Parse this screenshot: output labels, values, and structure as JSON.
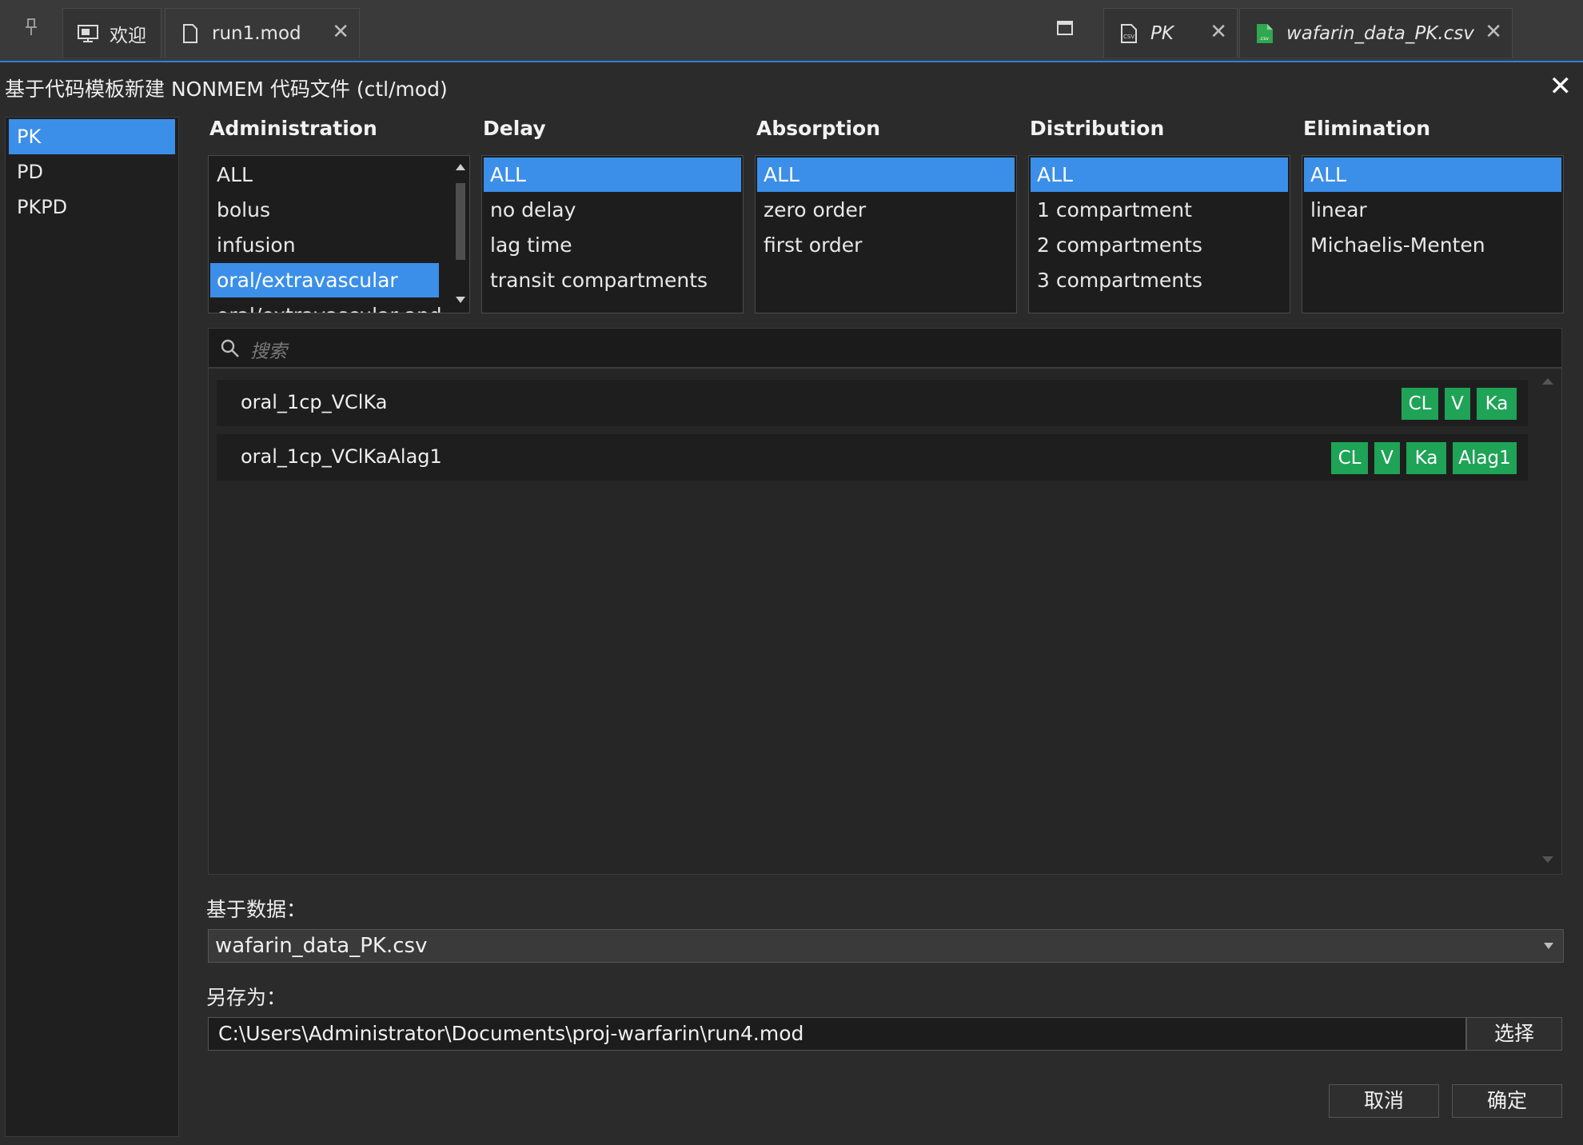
{
  "tabs": [
    {
      "label": "欢迎",
      "icon": "monitor-icon"
    },
    {
      "label": "run1.mod",
      "icon": "file-icon"
    },
    {
      "label": "PK",
      "icon": "csv-file-icon"
    },
    {
      "label": "wafarin_data_PK.csv",
      "icon": "csv-green-icon"
    }
  ],
  "dialog": {
    "title": "基于代码模板新建 NONMEM 代码文件 (ctl/mod)",
    "close_label": "✕"
  },
  "sidebar": {
    "items": [
      {
        "label": "PK",
        "selected": true
      },
      {
        "label": "PD",
        "selected": false
      },
      {
        "label": "PKPD",
        "selected": false
      }
    ]
  },
  "filters": {
    "administration": {
      "title": "Administration",
      "options": [
        "ALL",
        "bolus",
        "infusion",
        "oral/extravascular",
        "oral/extravascular and ..."
      ],
      "selected": "oral/extravascular"
    },
    "delay": {
      "title": "Delay",
      "options": [
        "ALL",
        "no delay",
        "lag time",
        "transit compartments"
      ],
      "selected": "ALL"
    },
    "absorption": {
      "title": "Absorption",
      "options": [
        "ALL",
        "zero order",
        "first order"
      ],
      "selected": "ALL"
    },
    "distribution": {
      "title": "Distribution",
      "options": [
        "ALL",
        "1 compartment",
        "2 compartments",
        "3 compartments"
      ],
      "selected": "ALL"
    },
    "elimination": {
      "title": "Elimination",
      "options": [
        "ALL",
        "linear",
        "Michaelis-Menten"
      ],
      "selected": "ALL"
    }
  },
  "search": {
    "placeholder": "搜索"
  },
  "results": [
    {
      "name": "oral_1cp_VClKa",
      "tags": [
        "CL",
        "V",
        "Ka"
      ]
    },
    {
      "name": "oral_1cp_VClKaAlag1",
      "tags": [
        "CL",
        "V",
        "Ka",
        "Alag1"
      ]
    }
  ],
  "data_label": "基于数据：",
  "data_value": "wafarin_data_PK.csv",
  "save_label": "另存为：",
  "save_path": "C:\\Users\\Administrator\\Documents\\proj-warfarin\\run4.mod",
  "buttons": {
    "choose": "选择",
    "cancel": "取消",
    "ok": "确定"
  },
  "colors": {
    "accent": "#3b8fe8",
    "tag_green": "#1fa356"
  }
}
